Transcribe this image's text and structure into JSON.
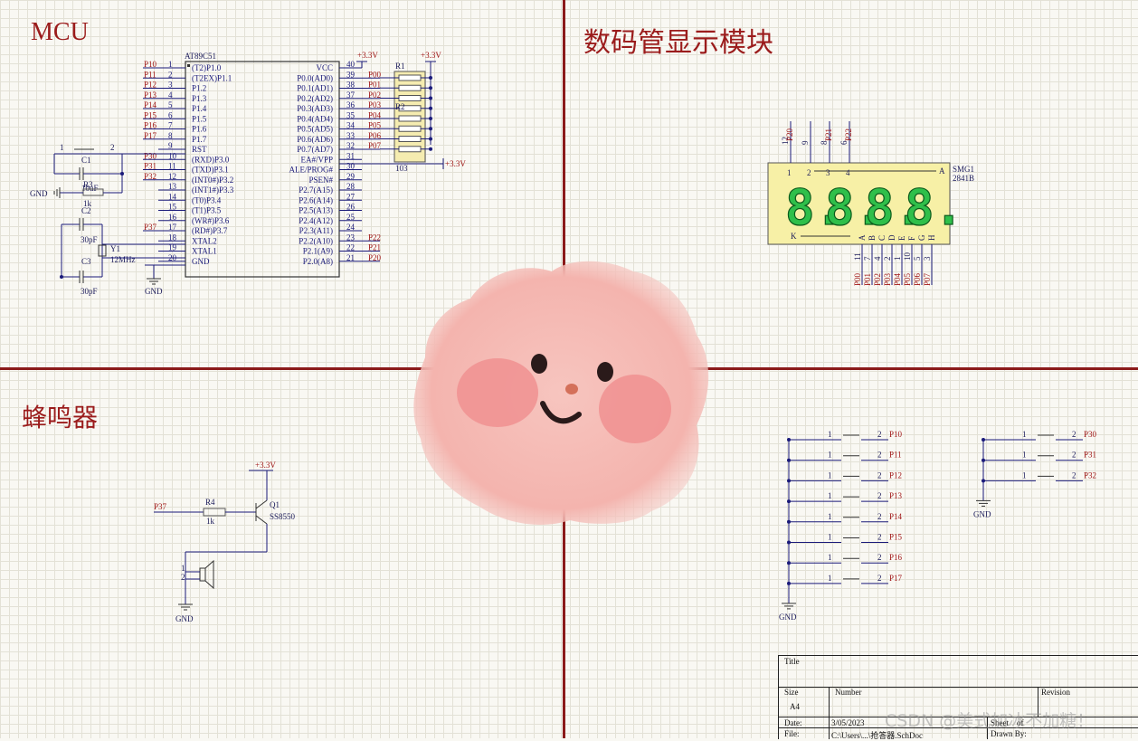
{
  "sections": {
    "mcu": "MCU",
    "display": "数码管显示模块",
    "buzzer": "蜂鸣器"
  },
  "mcu": {
    "chip_name": "AT89C51",
    "left_pins": [
      {
        "net": "P10",
        "num": "1",
        "name": "(T2)P1.0"
      },
      {
        "net": "P11",
        "num": "2",
        "name": "(T2EX)P1.1"
      },
      {
        "net": "P12",
        "num": "3",
        "name": "P1.2"
      },
      {
        "net": "P13",
        "num": "4",
        "name": "P1.3"
      },
      {
        "net": "P14",
        "num": "5",
        "name": "P1.4"
      },
      {
        "net": "P15",
        "num": "6",
        "name": "P1.5"
      },
      {
        "net": "P16",
        "num": "7",
        "name": "P1.6"
      },
      {
        "net": "P17",
        "num": "8",
        "name": "P1.7"
      },
      {
        "net": "",
        "num": "9",
        "name": "RST"
      },
      {
        "net": "P30",
        "num": "10",
        "name": "(RXD)P3.0"
      },
      {
        "net": "P31",
        "num": "11",
        "name": "(TXD)P3.1"
      },
      {
        "net": "P32",
        "num": "12",
        "name": "(INT0#)P3.2"
      },
      {
        "net": "",
        "num": "13",
        "name": "(INT1#)P3.3"
      },
      {
        "net": "",
        "num": "14",
        "name": "(T0)P3.4"
      },
      {
        "net": "",
        "num": "15",
        "name": "(T1)P3.5"
      },
      {
        "net": "",
        "num": "16",
        "name": "(WR#)P3.6"
      },
      {
        "net": "P37",
        "num": "17",
        "name": "(RD#)P3.7"
      },
      {
        "net": "",
        "num": "18",
        "name": "XTAL2"
      },
      {
        "net": "",
        "num": "19",
        "name": "XTAL1"
      },
      {
        "net": "",
        "num": "20",
        "name": "GND"
      }
    ],
    "right_pins": [
      {
        "net": "",
        "num": "40",
        "name": "VCC"
      },
      {
        "net": "P00",
        "num": "39",
        "name": "P0.0(AD0)"
      },
      {
        "net": "P01",
        "num": "38",
        "name": "P0.1(AD1)"
      },
      {
        "net": "P02",
        "num": "37",
        "name": "P0.2(AD2)"
      },
      {
        "net": "P03",
        "num": "36",
        "name": "P0.3(AD3)"
      },
      {
        "net": "P04",
        "num": "35",
        "name": "P0.4(AD4)"
      },
      {
        "net": "P05",
        "num": "34",
        "name": "P0.5(AD5)"
      },
      {
        "net": "P06",
        "num": "33",
        "name": "P0.6(AD6)"
      },
      {
        "net": "P07",
        "num": "32",
        "name": "P0.7(AD7)"
      },
      {
        "net": "",
        "num": "31",
        "name": "EA#/VPP"
      },
      {
        "net": "",
        "num": "30",
        "name": "ALE/PROG#"
      },
      {
        "net": "",
        "num": "29",
        "name": "PSEN#"
      },
      {
        "net": "",
        "num": "28",
        "name": "P2.7(A15)"
      },
      {
        "net": "",
        "num": "27",
        "name": "P2.6(A14)"
      },
      {
        "net": "",
        "num": "26",
        "name": "P2.5(A13)"
      },
      {
        "net": "",
        "num": "25",
        "name": "P2.4(A12)"
      },
      {
        "net": "",
        "num": "24",
        "name": "P2.3(A11)"
      },
      {
        "net": "P22",
        "num": "23",
        "name": "P2.2(A10)"
      },
      {
        "net": "P21",
        "num": "22",
        "name": "P2.1(A9)"
      },
      {
        "net": "P20",
        "num": "21",
        "name": "P2.0(A8)"
      }
    ],
    "vcc_labels": [
      "+3.3V",
      "+3.3V",
      "+3.3V"
    ],
    "rpack": {
      "ref": "R1",
      "ref2": "R2",
      "value": "103"
    },
    "c1": {
      "ref": "C1",
      "value": "10uF"
    },
    "r3": {
      "ref": "R3",
      "value": "1k"
    },
    "c2": {
      "ref": "C2",
      "value": "30pF"
    },
    "c3": {
      "ref": "C3",
      "value": "30pF"
    },
    "y1": {
      "ref": "Y1",
      "value": "12MHz"
    },
    "sw_pins": [
      "1",
      "2"
    ],
    "gnd": "GND"
  },
  "display": {
    "ref": "SMG1",
    "part": "2841B",
    "top_nets": [
      "P20",
      "P21",
      "P22"
    ],
    "top_pins": [
      "12",
      "9",
      "8",
      "6"
    ],
    "inner_top": [
      "1",
      "2",
      "3",
      "4"
    ],
    "anode_label": "A",
    "cathode_label": "K",
    "digits": [
      "8.",
      "8.",
      "8.",
      "8."
    ],
    "seg_letters": [
      "A",
      "B",
      "C",
      "D",
      "E",
      "F",
      "G",
      "H"
    ],
    "seg_pins": [
      "11",
      "7",
      "4",
      "2",
      "1",
      "10",
      "5",
      "3"
    ],
    "seg_nets": [
      "P00",
      "P01",
      "P02",
      "P03",
      "P04",
      "P05",
      "P06",
      "P07"
    ]
  },
  "buzzer": {
    "vcc": "+3.3V",
    "net_in": "P37",
    "r_ref": "R4",
    "r_val": "1k",
    "q_ref": "Q1",
    "q_part": "SS8550",
    "spk_pins": [
      "1",
      "2"
    ],
    "gnd": "GND"
  },
  "keys": {
    "group1": [
      "P10",
      "P11",
      "P12",
      "P13",
      "P14",
      "P15",
      "P16",
      "P17"
    ],
    "group2": [
      "P30",
      "P31",
      "P32"
    ],
    "pin_left": "1",
    "pin_right": "2",
    "gnd": "GND"
  },
  "title_block": {
    "title_label": "Title",
    "size_label": "Size",
    "size_value": "A4",
    "number_label": "Number",
    "revision_label": "Revision",
    "date_label": "Date:",
    "date_value": "3/05/2023",
    "sheet_label": "Sheet",
    "of_label": "of",
    "file_label": "File:",
    "file_value": "C:\\Users\\...\\抢答器.SchDoc",
    "drawn_label": "Drawn By:"
  },
  "watermark": "CSDN @美式加冰不加糖！",
  "colors": {
    "divider": "#8b1a1a",
    "net": "#a01515",
    "pin": "#1a1a7a",
    "blob": "#f4b6b0"
  }
}
